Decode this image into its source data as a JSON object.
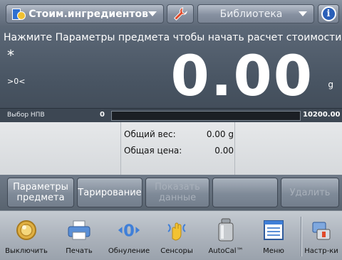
{
  "topbar": {
    "app_name": "Стоим.ингредиентов",
    "app_icon": "ingredient-cost-icon",
    "wrench_icon": "wrench-icon",
    "library_label": "Библиотека",
    "info_icon": "info-icon",
    "info_glyph": "i"
  },
  "display": {
    "message": "Нажмите Параметры предмета чтобы начать расчет стоимости.",
    "stable_indicator": "*",
    "zero_indicator": ">0<",
    "weight": "0.00",
    "unit": "g"
  },
  "capacity": {
    "label": "Выбор НПВ",
    "min": "0",
    "max": "10200.00",
    "fill_fraction": 0
  },
  "data_panel": {
    "total_weight_label": "Общий вес:",
    "total_weight_value": "0.00 g",
    "total_price_label": "Общая цена:",
    "total_price_value": "0.00"
  },
  "softkeys": {
    "item_params": "Параметры предмета",
    "tare": "Тарирование",
    "show_data": "Показать данные",
    "blank": "",
    "delete": "Удалить"
  },
  "nav": [
    {
      "label": "Выключить",
      "icon": "power-icon"
    },
    {
      "label": "Печать",
      "icon": "printer-icon"
    },
    {
      "label": "Обнуление",
      "icon": "zero-icon"
    },
    {
      "label": "Сенсоры",
      "icon": "sensor-hand-icon"
    },
    {
      "label": "AutoCal™",
      "icon": "autocal-weight-icon"
    },
    {
      "label": "Меню",
      "icon": "menu-icon"
    },
    {
      "label": "Настр-ки",
      "icon": "settings-icon"
    }
  ],
  "colors": {
    "display_bg": "#485462",
    "capacity_fill": "#6fbf40",
    "panel_bg": "#dfe2e5"
  }
}
